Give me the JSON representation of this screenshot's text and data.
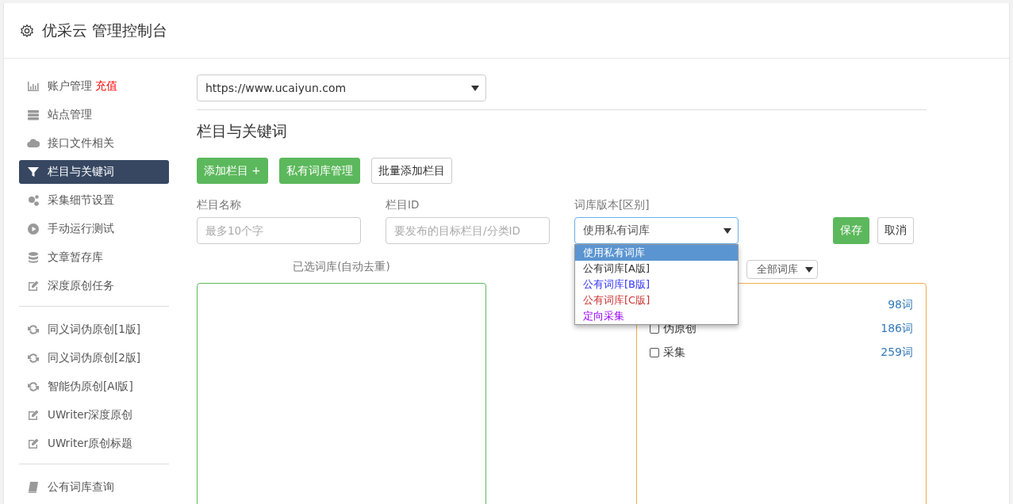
{
  "header": {
    "title": "优采云 管理控制台"
  },
  "sidebar": {
    "groups": [
      {
        "items": [
          {
            "label": "账户管理",
            "badge": "充值",
            "selected": false
          },
          {
            "label": "站点管理",
            "selected": false
          },
          {
            "label": "接口文件相关",
            "selected": false
          },
          {
            "label": "栏目与关键词",
            "selected": true
          },
          {
            "label": "采集细节设置",
            "selected": false
          },
          {
            "label": "手动运行测试",
            "selected": false
          },
          {
            "label": "文章暂存库",
            "selected": false
          },
          {
            "label": "深度原创任务",
            "selected": false
          }
        ]
      },
      {
        "items": [
          {
            "label": "同义词伪原创[1版]",
            "selected": false
          },
          {
            "label": "同义词伪原创[2版]",
            "selected": false
          },
          {
            "label": "智能伪原创[AI版]",
            "selected": false
          },
          {
            "label": "UWriter深度原创",
            "selected": false
          },
          {
            "label": "UWriter原创标题",
            "selected": false
          }
        ]
      },
      {
        "items": [
          {
            "label": "公有词库查询",
            "selected": false
          }
        ]
      }
    ]
  },
  "site_select": {
    "value": "https://www.ucaiyun.com"
  },
  "section_title": "栏目与关键词",
  "buttons": [
    {
      "label": "添加栏目 +",
      "kind": "primary"
    },
    {
      "label": "私有词库管理",
      "kind": "primary"
    },
    {
      "label": "批量添加栏目",
      "kind": "default"
    }
  ],
  "form": {
    "name": {
      "label": "栏目名称",
      "placeholder": "最多10个字"
    },
    "id": {
      "label": "栏目ID",
      "placeholder": "要发布的目标栏目/分类ID"
    },
    "version": {
      "label": "词库版本[区别]",
      "value": "使用私有词库",
      "expanded": true,
      "options": [
        {
          "label": "使用私有词库",
          "selected": true
        },
        {
          "label": "公有词库[A版]",
          "selected": false,
          "color": "#333333"
        },
        {
          "label": "公有词库[B版]",
          "selected": false,
          "color": "#3333ff"
        },
        {
          "label": "公有词库[C版]",
          "selected": false,
          "color": "#cc3333"
        },
        {
          "label": "定向采集",
          "selected": false,
          "color": "#9900ff"
        }
      ]
    },
    "save": "保存",
    "cancel": "取消"
  },
  "selected_panel": {
    "title": "已选词库(自动去重)"
  },
  "library_filter": {
    "value": "全部词库"
  },
  "libraries": [
    {
      "count": "98词"
    },
    {
      "label": "伪原创",
      "count": "186词",
      "checked": false
    },
    {
      "label": "采集",
      "count": "259词",
      "checked": false
    }
  ]
}
